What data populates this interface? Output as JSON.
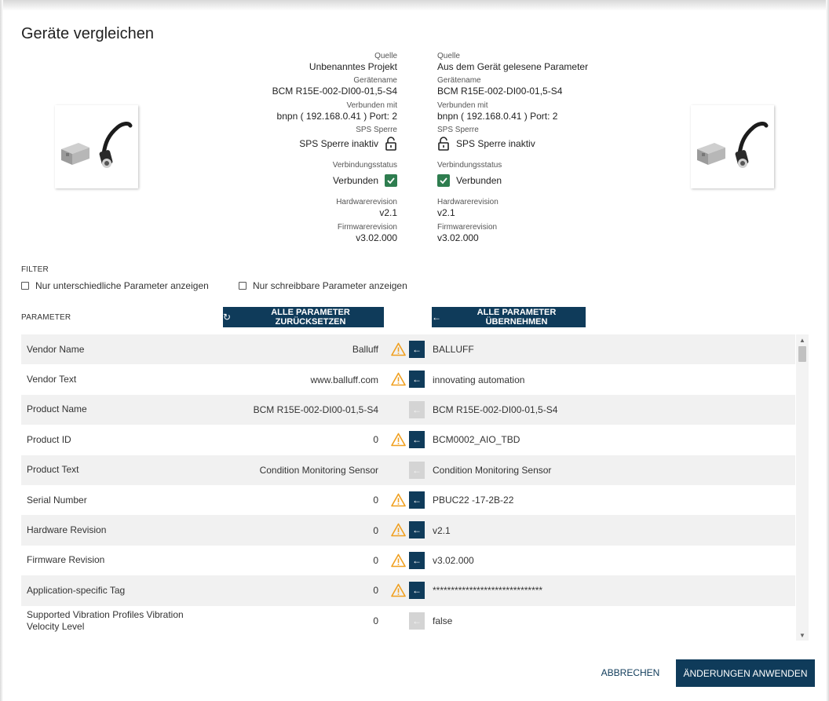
{
  "dialog": {
    "title": "Geräte vergleichen"
  },
  "left_device": {
    "source_label": "Quelle",
    "source_value": "Unbenanntes Projekt",
    "name_label": "Gerätename",
    "name_value": "BCM R15E-002-DI00-01,5-S4",
    "connected_label": "Verbunden mit",
    "connected_value": "bnpn ( 192.168.0.41 ) Port: 2",
    "sps_label": "SPS Sperre",
    "sps_value": "SPS Sperre inaktiv",
    "status_label": "Verbindungsstatus",
    "status_value": "Verbunden",
    "hw_label": "Hardwarerevision",
    "hw_value": "v2.1",
    "fw_label": "Firmwarerevision",
    "fw_value": "v3.02.000"
  },
  "right_device": {
    "source_label": "Quelle",
    "source_value": "Aus dem Gerät gelesene Parameter",
    "name_label": "Gerätename",
    "name_value": "BCM R15E-002-DI00-01,5-S4",
    "connected_label": "Verbunden mit",
    "connected_value": "bnpn ( 192.168.0.41 ) Port: 2",
    "sps_label": "SPS Sperre",
    "sps_value": "SPS Sperre inaktiv",
    "status_label": "Verbindungsstatus",
    "status_value": "Verbunden",
    "hw_label": "Hardwarerevision",
    "hw_value": "v2.1",
    "fw_label": "Firmwarerevision",
    "fw_value": "v3.02.000"
  },
  "filter": {
    "heading": "FILTER",
    "option_different": "Nur unterschiedliche Parameter anzeigen",
    "option_writable": "Nur schreibbare Parameter anzeigen"
  },
  "parameters": {
    "heading": "PARAMETER",
    "reset_all_label": "ALLE PARAMETER ZURÜCKSETZEN",
    "apply_all_label": "ALLE PARAMETER ÜBERNEHMEN",
    "rows": [
      {
        "name": "Vendor Name",
        "left": "Balluff",
        "right": "BALLUFF",
        "differs": true
      },
      {
        "name": "Vendor Text",
        "left": "www.balluff.com",
        "right": "innovating automation",
        "differs": true
      },
      {
        "name": "Product Name",
        "left": "BCM R15E-002-DI00-01,5-S4",
        "right": "BCM R15E-002-DI00-01,5-S4",
        "differs": false
      },
      {
        "name": "Product ID",
        "left": "0",
        "right": "BCM0002_AIO_TBD",
        "differs": true
      },
      {
        "name": "Product Text",
        "left": "Condition Monitoring Sensor",
        "right": "Condition Monitoring Sensor",
        "differs": false
      },
      {
        "name": "Serial Number",
        "left": "0",
        "right": "PBUC22 -17-2B-22",
        "differs": true
      },
      {
        "name": "Hardware Revision",
        "left": "0",
        "right": "v2.1",
        "differs": true
      },
      {
        "name": "Firmware Revision",
        "left": "0",
        "right": "v3.02.000",
        "differs": true
      },
      {
        "name": "Application-specific Tag",
        "left": "0",
        "right": "******************************",
        "differs": true
      },
      {
        "name": "Supported Vibration Profiles Vibration Velocity Level",
        "left": "0",
        "right": "false",
        "differs": false
      }
    ]
  },
  "footer": {
    "cancel_label": "ABBRECHEN",
    "apply_label": "ÄNDERUNGEN ANWENDEN"
  },
  "colors": {
    "primary": "#0f3b5a",
    "warning": "#f0a020",
    "success": "#2e7d4f",
    "row_alt": "#f1f1f1"
  },
  "icons": {
    "arrow": "arrow-left-icon",
    "warning": "warning-icon",
    "lock": "lock-open-icon",
    "check": "checkbox-checked-icon",
    "reset": "refresh-icon"
  }
}
